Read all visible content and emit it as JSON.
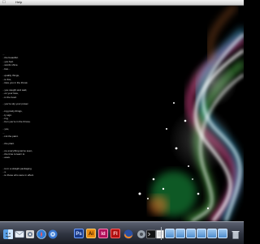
{
  "menubar": {
    "apple_icon": "apple-icon",
    "help_label": "Help"
  },
  "desktop": {
    "wallpaper": "abstract glowing light ribbons",
    "accent_colors": [
      "#ffffff",
      "#6fd0ff",
      "#ff5aa8",
      "#8cff7a",
      "#ff9a4a"
    ]
  },
  "notes": {
    "lines": [
      "...",
      "...the beautiful.",
      "...you feel.",
      "...words shine.",
      "...lies...",
      "",
      "...quality things,",
      "...to live,",
      "...face you in the throat.",
      "",
      "...you caught and said,",
      "...on your face,",
      "...in the bowl.",
      "",
      "...you're sky your power.",
      "",
      "...ing pretty things,",
      "...ly sign.",
      "...ing,",
      "...hen you're in the throne.",
      "",
      "...you,",
      "...",
      "...ink the paint.",
      "",
      "...the plant.",
      "",
      "...ne everything we've seen,",
      "...the time to learn to",
      "...eave.",
      "",
      "",
      "...ts in a straight packaging.",
      "...s.",
      "...to those who were in effect."
    ]
  },
  "dock": {
    "items": [
      {
        "name": "finder",
        "icon": "finder-icon"
      },
      {
        "name": "mail",
        "icon": "mail-icon"
      },
      {
        "name": "preview",
        "icon": "preview-icon"
      },
      {
        "name": "safari",
        "icon": "safari-icon"
      },
      {
        "name": "itunes",
        "icon": "itunes-icon"
      },
      {
        "name": "photoshop",
        "label": "Ps"
      },
      {
        "name": "illustrator",
        "label": "Ai"
      },
      {
        "name": "indesign",
        "label": "Id"
      },
      {
        "name": "flash",
        "label": "Fl"
      },
      {
        "name": "firefox",
        "icon": "firefox-icon"
      },
      {
        "name": "system-preferences",
        "icon": "gear-icon"
      },
      {
        "name": "terminal",
        "icon": "terminal-icon"
      },
      {
        "name": "textedit",
        "icon": "textedit-icon"
      }
    ],
    "folders": 8,
    "trash_icon": "trash-icon"
  }
}
